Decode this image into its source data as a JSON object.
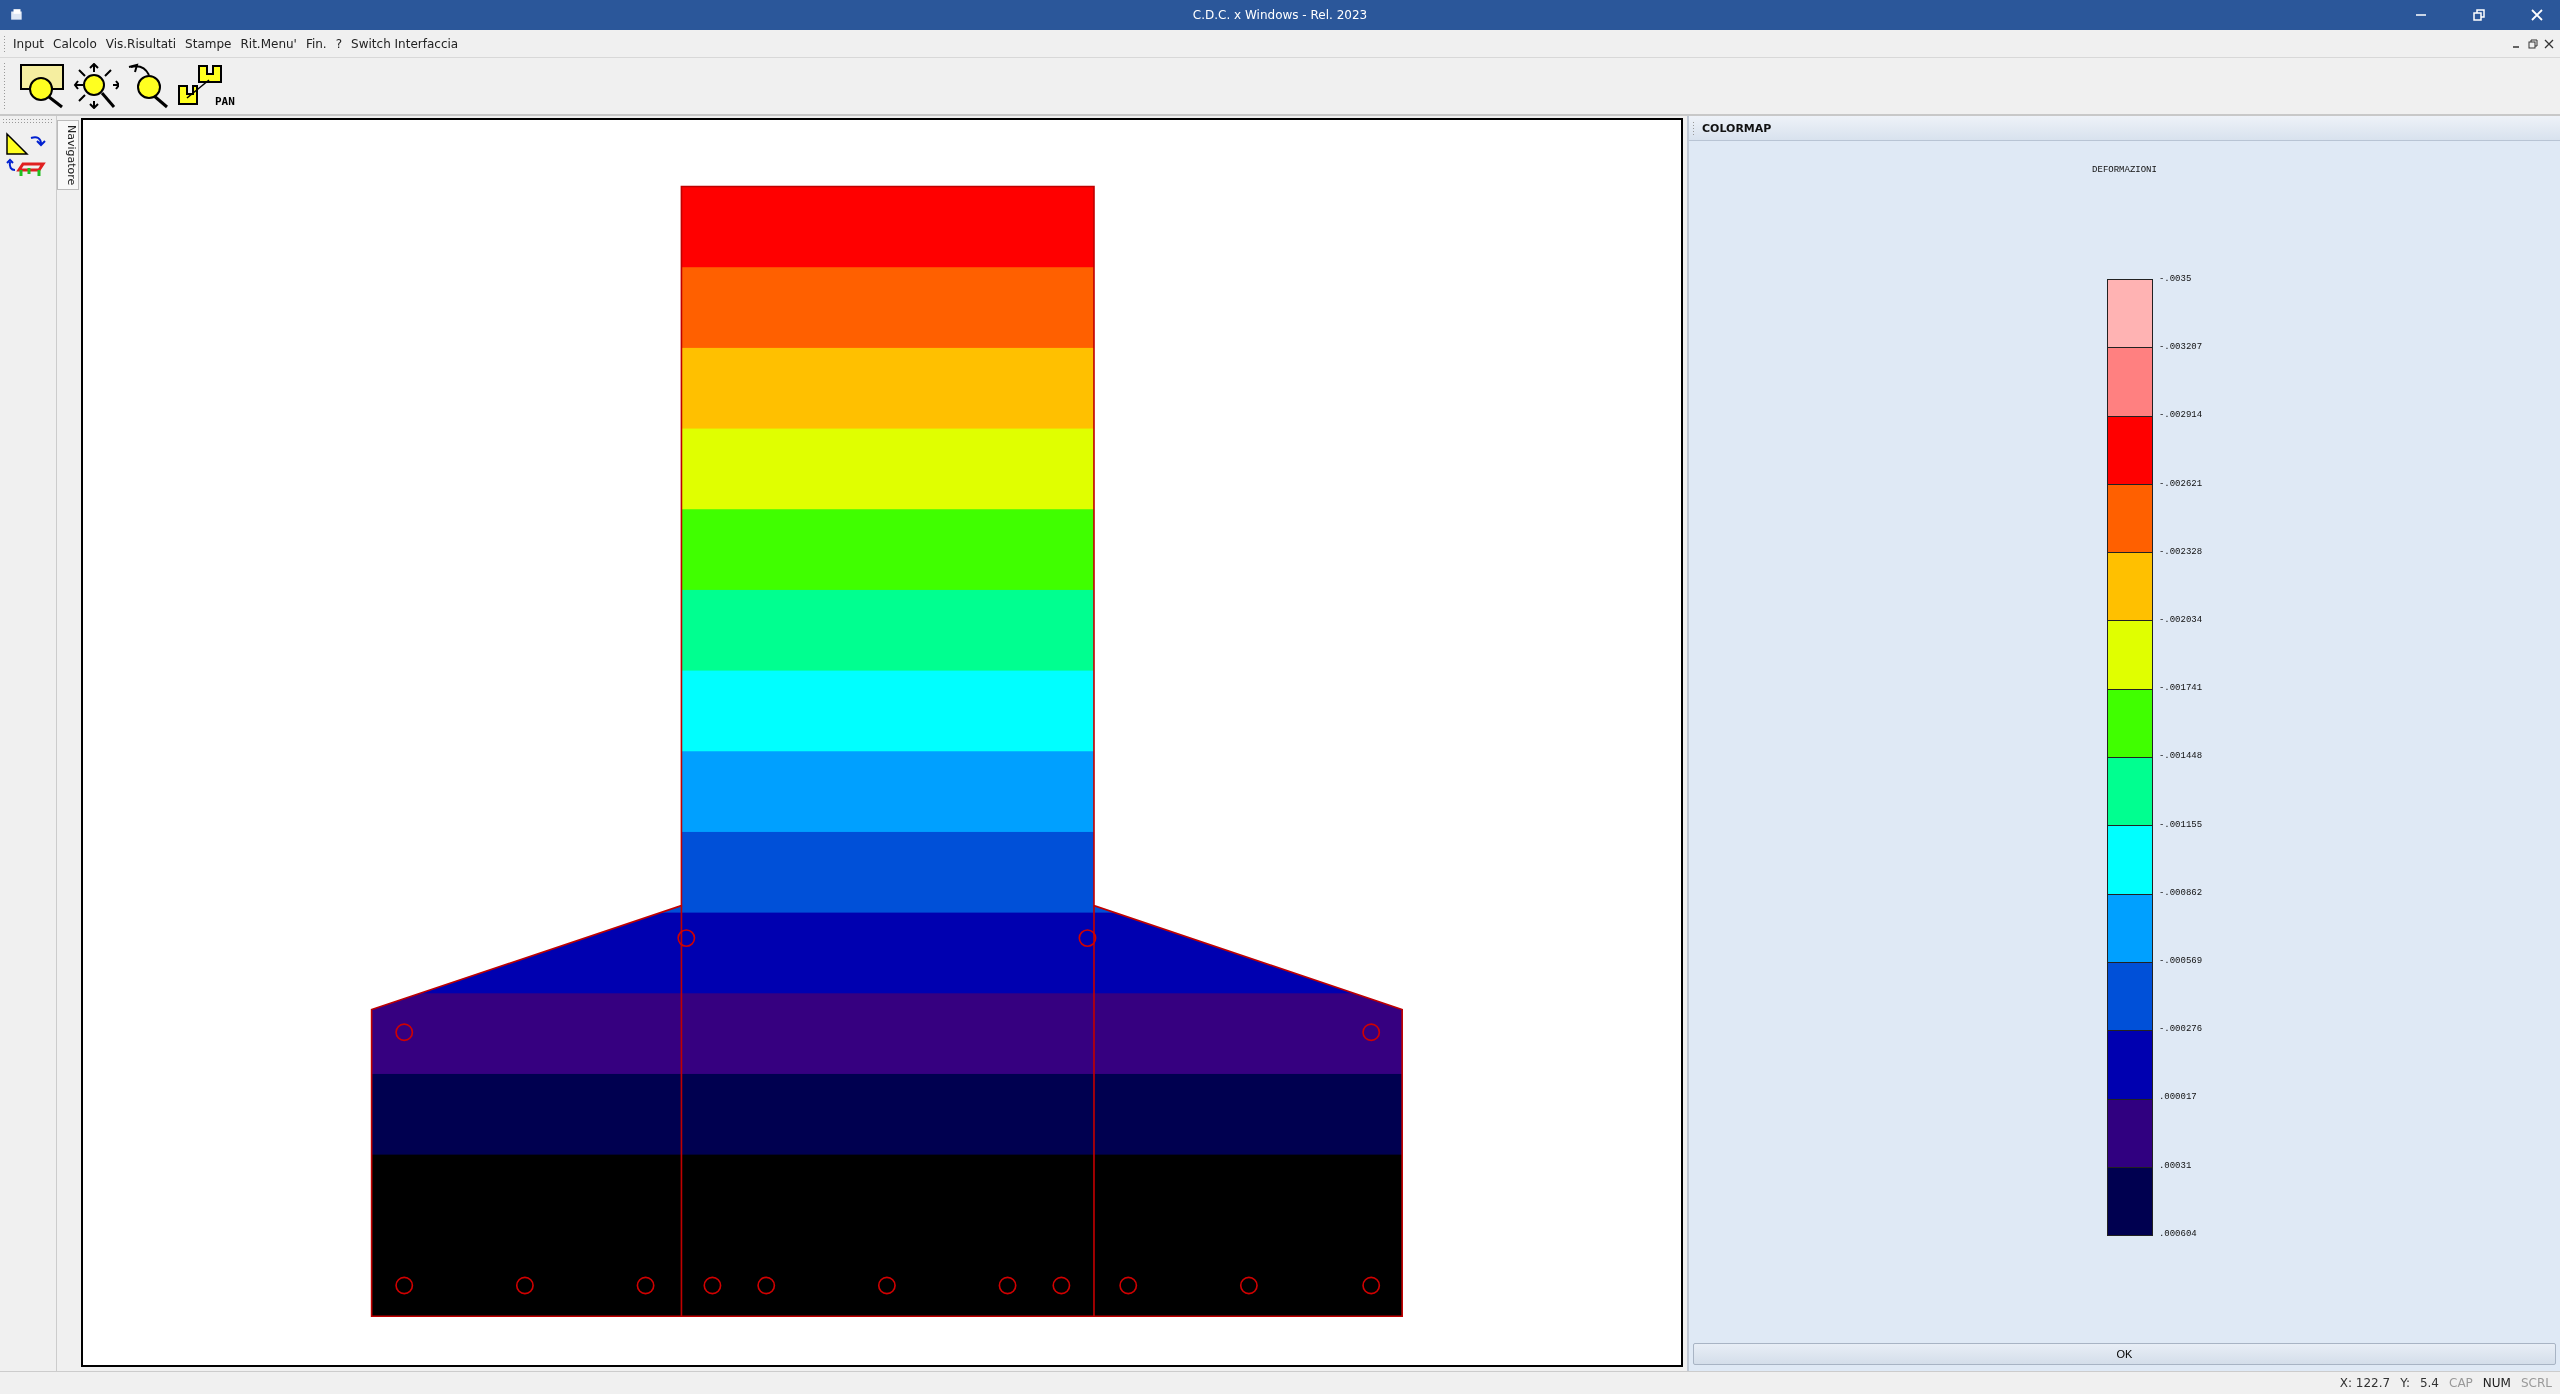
{
  "window": {
    "title": "C.D.C. x Windows - Rel. 2023"
  },
  "menu": [
    "Input",
    "Calcolo",
    "Vis.Risultati",
    "Stampe",
    "Rit.Menu'",
    "Fin.",
    "?",
    "Switch Interfaccia"
  ],
  "toolbar": [
    {
      "kind": "zoom-window"
    },
    {
      "kind": "zoom-all"
    },
    {
      "kind": "zoom-previous"
    },
    {
      "kind": "pan",
      "label": "PAN"
    }
  ],
  "navigator": {
    "label": "Navigatore"
  },
  "colormap": {
    "title": "COLORMAP",
    "heading": "DEFORMAZIONI",
    "bands": [
      {
        "color": "#ffb3b3"
      },
      {
        "color": "#ff8080"
      },
      {
        "color": "#ff0000"
      },
      {
        "color": "#ff6000"
      },
      {
        "color": "#ffc000"
      },
      {
        "color": "#e0ff00"
      },
      {
        "color": "#40ff00"
      },
      {
        "color": "#00ff90"
      },
      {
        "color": "#00ffff"
      },
      {
        "color": "#00a0ff"
      },
      {
        "color": "#0050d8"
      },
      {
        "color": "#0000b0"
      },
      {
        "color": "#300080"
      },
      {
        "color": "#000050"
      }
    ],
    "ticks": [
      "-.0035",
      "-.003207",
      "-.002914",
      "-.002621",
      "-.002328",
      "-.002034",
      "-.001741",
      "-.001448",
      "-.001155",
      "-.000862",
      "-.000569",
      "-.000276",
      ".000017",
      ".00031",
      ".000604"
    ],
    "ok": "OK"
  },
  "status_bar": {
    "x_label": "X: 122.7",
    "y_label": "Y:",
    "y_value": "5.4",
    "indicators": [
      {
        "label": "CAP",
        "on": false
      },
      {
        "label": "NUM",
        "on": true
      },
      {
        "label": "SCRL",
        "on": false
      }
    ]
  }
}
